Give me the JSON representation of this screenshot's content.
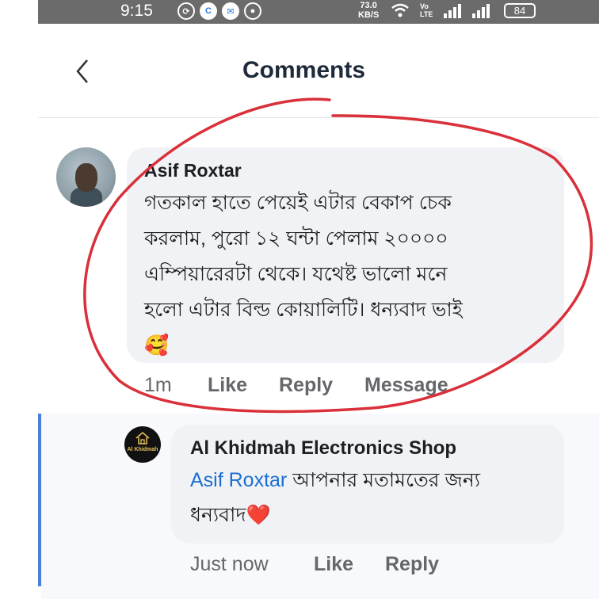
{
  "status_bar": {
    "time": "9:15",
    "net_speed_value": "73.0",
    "net_speed_unit": "KB/S",
    "volte_label": "Vo\nLTE",
    "battery": "84"
  },
  "header": {
    "title": "Comments",
    "back_icon": "chevron-left-icon"
  },
  "comments": [
    {
      "author": "Asif Roxtar",
      "lines": [
        "গতকাল হাতে পেয়েই এটার বেকাপ চেক",
        "করলাম,  পুরো ১২ ঘন্টা পেলাম ২০০০০",
        "এম্পিয়ারেরটা থেকে। যথেষ্ট ভালো মনে",
        "হলো এটার বিল্ড কোয়ালিটি। ধন্যবাদ ভাই"
      ],
      "emoji": "🥰",
      "time": "1m",
      "actions": [
        "Like",
        "Reply",
        "Message"
      ]
    }
  ],
  "reply": {
    "author": "Al Khidmah Electronics Shop",
    "avatar_label": "Al Khidmah",
    "mention": "Asif Roxtar",
    "line1_rest": " আপনার মতামতের জন্য",
    "line2": "ধন্যবাদ",
    "emoji": "❤️",
    "time": "Just now",
    "actions": [
      "Like",
      "Reply"
    ]
  },
  "colors": {
    "status_bar_bg": "#6b6b6b",
    "title_color": "#1f2a3a",
    "bubble_bg": "#f0f2f5",
    "mention_link": "#1a6fd1",
    "thread_line": "#4a7fd9",
    "annotation_stroke": "#d9303a"
  }
}
